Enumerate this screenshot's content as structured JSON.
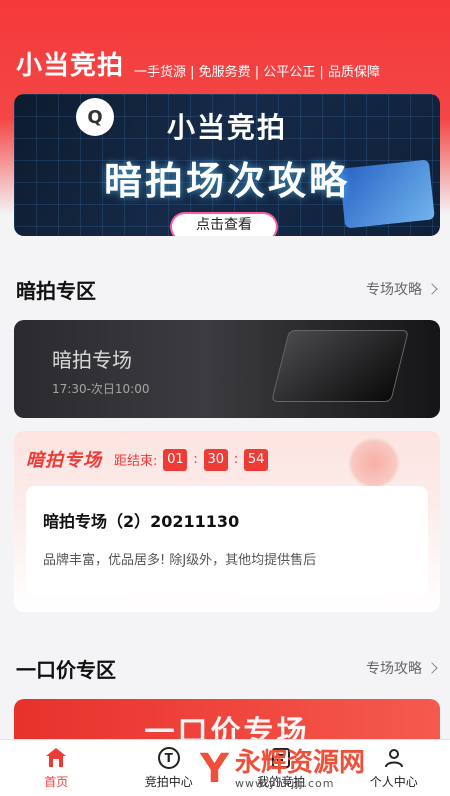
{
  "header": {
    "app_title": "小当竞拍",
    "slogan": "一手货源 | 免服务费 | 公平公正 | 品质保障"
  },
  "banner": {
    "title": "小当竞拍",
    "subtitle": "暗拍场次攻略",
    "button_label": "点击查看"
  },
  "sections": {
    "dark_auction": {
      "title": "暗拍专区",
      "link_label": "专场攻略"
    },
    "fixed_price": {
      "title": "一口价专区",
      "link_label": "专场攻略"
    }
  },
  "dark_card": {
    "title": "暗拍专场",
    "time": "17:30-次日10:00"
  },
  "auction_card": {
    "brand": "暗拍专场",
    "countdown_label": "距结束:",
    "countdown": {
      "hours": "01",
      "minutes": "30",
      "seconds": "54"
    },
    "name": "暗拍专场（2）20211130",
    "description": "品牌丰富，优品居多! 除J级外，其他均提供售后"
  },
  "fixed_price_card": {
    "title": "一口价专场"
  },
  "tabbar": {
    "tabs": [
      {
        "label": "首页",
        "icon": "home-icon",
        "active": true
      },
      {
        "label": "竞拍中心",
        "icon": "auction-center-icon",
        "active": false
      },
      {
        "label": "我的竞拍",
        "icon": "my-auction-icon",
        "active": false
      },
      {
        "label": "个人中心",
        "icon": "profile-icon",
        "active": false
      }
    ]
  },
  "watermark": {
    "name": "永辉资源网",
    "url": "www.yhkjjj.com"
  },
  "colors": {
    "brand_red": "#ef3b36",
    "header_red": "#f5393a"
  }
}
